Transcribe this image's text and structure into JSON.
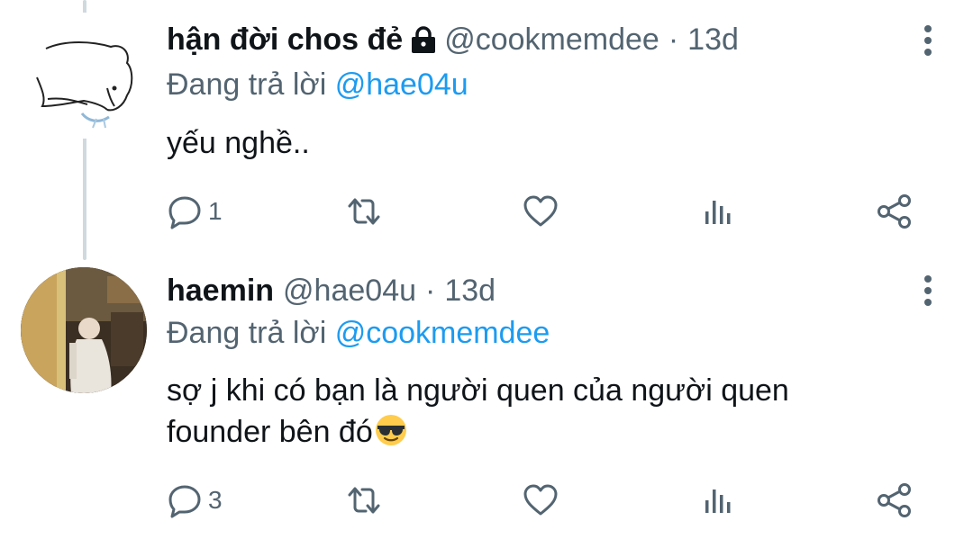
{
  "tweets": [
    {
      "display_name": "hận đời chos đẻ",
      "protected": true,
      "handle": "@cookmemdee",
      "separator": "·",
      "time": "13d",
      "reply_prefix": "Đang trả lời ",
      "reply_to": "@hae04u",
      "text_lines": [
        "yếu nghề.."
      ],
      "reply_count": "1",
      "avatar": "sketch-drawing-avatar"
    },
    {
      "display_name": "haemin",
      "protected": false,
      "handle": "@hae04u",
      "separator": "·",
      "time": "13d",
      "reply_prefix": "Đang trả lời ",
      "reply_to": "@cookmemdee",
      "text_lines": [
        "sợ j khi có bạn là người quen của người quen",
        "founder bên đó"
      ],
      "emoji": "sunglasses-emoji",
      "reply_count": "3",
      "avatar": "photo-avatar"
    }
  ],
  "icons": {
    "reply": "reply-icon",
    "retweet": "retweet-icon",
    "like": "heart-icon",
    "analytics": "analytics-icon",
    "share": "share-icon",
    "more": "more-icon",
    "lock": "lock-icon"
  },
  "colors": {
    "text": "#0f1419",
    "secondary": "#536471",
    "accent": "#1d9bf0",
    "thread_line": "#cfd9de"
  }
}
